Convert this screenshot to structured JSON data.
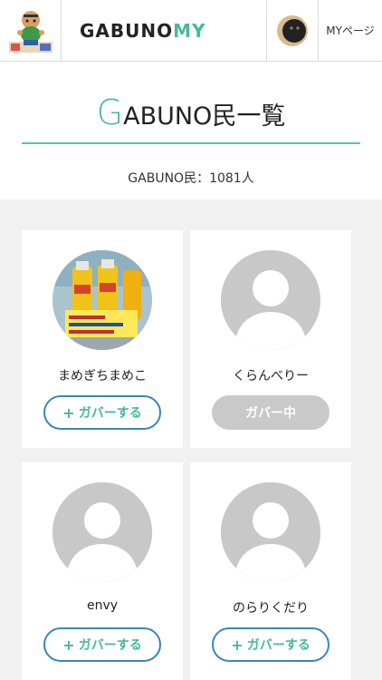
{
  "header": {
    "brand_part1": "GABUNO",
    "brand_part2": "MY",
    "mypage_label": "MYページ"
  },
  "title": {
    "first_letter": "G",
    "rest": "ABUNO民一覧"
  },
  "member_count": "GABUNO民：1081人",
  "users": [
    {
      "name": "まめぎちまめこ",
      "button": "ガバーする",
      "followed": false,
      "avatar": "photo-avatar"
    },
    {
      "name": "くらんべりー",
      "button": "ガバー中",
      "followed": true,
      "avatar": "default-user-icon"
    },
    {
      "name": "envy",
      "button": "ガバーする",
      "followed": false,
      "avatar": "default-user-icon"
    },
    {
      "name": "のらりくだり",
      "button": "ガバーする",
      "followed": false,
      "avatar": "default-user-icon"
    }
  ],
  "colors": {
    "accent": "#47b99a",
    "button_border": "#3a86b8",
    "followed_bg": "#c9c9c9"
  }
}
